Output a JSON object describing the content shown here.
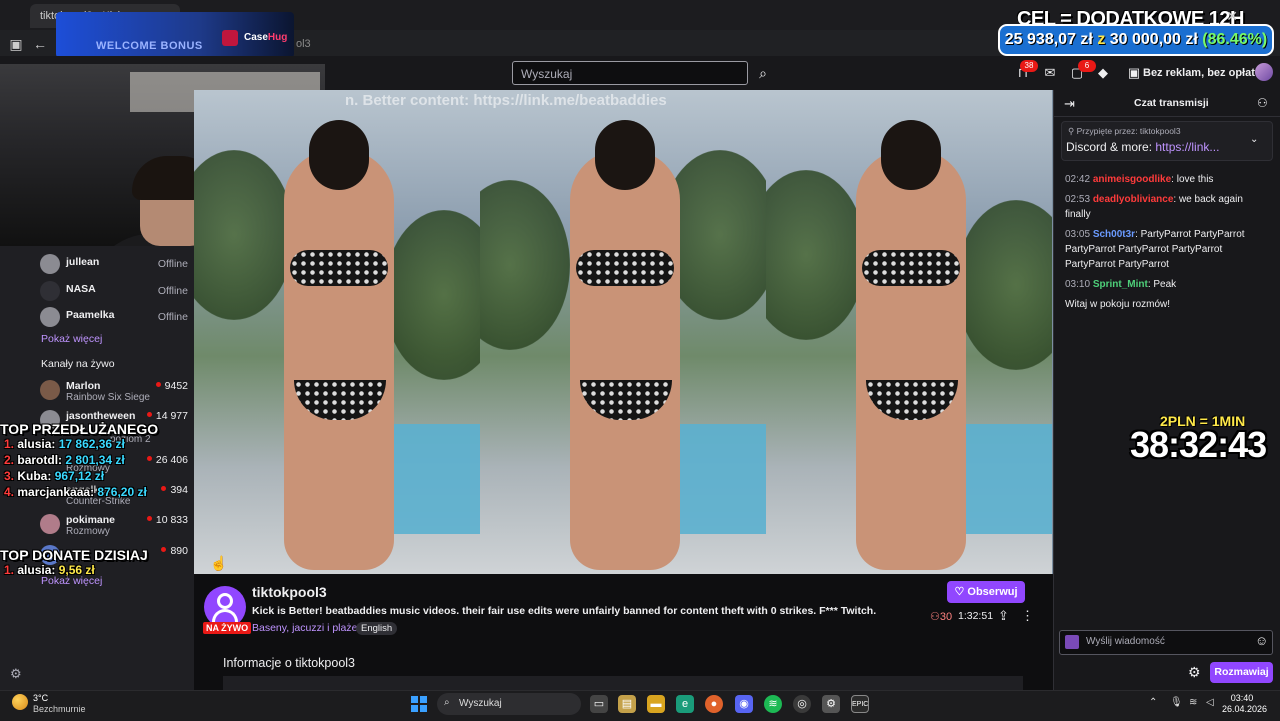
{
  "browser": {
    "tab_title": "tiktokpool3 - Kick",
    "url_fragment": "ol3"
  },
  "ad": {
    "bonus": "WELCOME BONUS",
    "brand_a": "Case",
    "brand_b": "Hug"
  },
  "goal": {
    "title": "CEL = DODATKOWE 12H",
    "current": "25 938,07 zł",
    "sep": "z",
    "target": "30 000,00 zł",
    "percent": "(86.46%)"
  },
  "header": {
    "search_placeholder": "Wyszukaj",
    "badge_notifications": "38",
    "badge_messages": "6",
    "adfree_label": "Bez reklam, bez opłat"
  },
  "sidebar": {
    "followed": [
      {
        "name": "jullean",
        "status": "Offline"
      },
      {
        "name": "NASA",
        "status": "Offline"
      },
      {
        "name": "Paamelka",
        "status": "Offline"
      }
    ],
    "show_more": "Pokaż więcej",
    "live_title": "Kanały na żywo",
    "live": [
      {
        "name": "Marlon",
        "game": "Rainbow Six Siege",
        "viewers": "9452"
      },
      {
        "name": "jasontheween",
        "game": "poziom 2",
        "viewers": "14 977"
      },
      {
        "name": "",
        "game": "Rozmowy",
        "viewers": "26 406"
      },
      {
        "name": "angelkaaa",
        "game": "Counter-Strike",
        "viewers": "394"
      },
      {
        "name": "pokimane",
        "game": "Rozmowy",
        "viewers": "10 833"
      },
      {
        "name": "",
        "game": "",
        "viewers": "890"
      }
    ],
    "show_more_2": "Pokaż więcej"
  },
  "overlay": {
    "top_title": "TOP PRZEDŁUŻANEGO",
    "top": [
      {
        "n": "1.",
        "name": "alusia:",
        "amount": "17 862,36 zł"
      },
      {
        "n": "2.",
        "name": "barotdl:",
        "amount": "2 801,34 zł"
      },
      {
        "n": "3.",
        "name": "Kuba:",
        "amount": "967,12 zł"
      },
      {
        "n": "4.",
        "name": "marcjankaaa:",
        "amount": "876,20 zł"
      }
    ],
    "donate_title": "TOP DONATE DZISIAJ",
    "donate": [
      {
        "n": "1.",
        "name": "alusia:",
        "amount": "9,56 zł"
      }
    ]
  },
  "video": {
    "watermark": "n. Better content: https://link.me/beatbaddies"
  },
  "stream": {
    "name": "tiktokpool3",
    "live_badge": "NA ŻYWO",
    "title": "Kick is Better! beatbaddies music videos. their fair use edits were unfairly banned for content theft with 0 strikes. F*** Twitch.",
    "category": "Baseny, jacuzzi i plaże",
    "tag": "English",
    "follow": "Obserwuj",
    "viewers": "30",
    "uptime": "1:32:51",
    "about": "Informacje o tiktokpool3"
  },
  "chat": {
    "title": "Czat transmisji",
    "pinned_by": "Przypięte przez: tiktokpool3",
    "pinned_text": "Discord & more:",
    "pinned_link": "https://link...",
    "messages": [
      {
        "time": "02:42",
        "user": "animeisgoodlike",
        "text": ": love this"
      },
      {
        "time": "02:53",
        "user": "deadlyobliviance",
        "text": ": we back again finally"
      },
      {
        "time": "03:05",
        "user": "Sch00t3r",
        "text": ": PartyParrot PartyParrot PartyParrot PartyParrot PartyParrot PartyParrot PartyParrot"
      },
      {
        "time": "03:10",
        "user": "Sprint_Mint",
        "text": ": Peak"
      }
    ],
    "welcome": "Witaj w pokoju rozmów!",
    "input_placeholder": "Wyślij wiadomość",
    "send": "Rozmawiaj"
  },
  "timer": {
    "label": "2PLN = 1MIN",
    "value": "38:32:43"
  },
  "taskbar": {
    "temp": "3°C",
    "weather": "Bezchmurnie",
    "search": "Wyszukaj",
    "time": "03:40",
    "date": "26.04.2026"
  }
}
